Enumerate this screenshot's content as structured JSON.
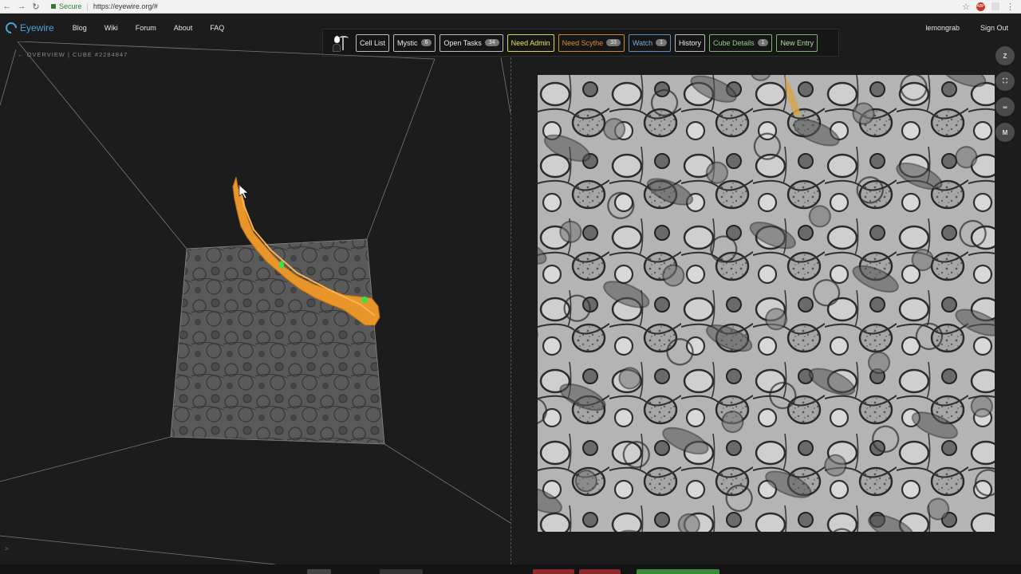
{
  "browser": {
    "secure_label": "Secure",
    "url": "https://eyewire.org/#"
  },
  "site": {
    "brand": "Eyewire",
    "nav": [
      "Blog",
      "Wiki",
      "Forum",
      "About",
      "FAQ"
    ],
    "user": "lemongrab",
    "sign_out": "Sign Out"
  },
  "toolbar": {
    "cell_list": "Cell List",
    "mystic": "Mystic",
    "mystic_count": "6",
    "open_tasks": "Open Tasks",
    "open_tasks_count": "34",
    "need_admin": "Need Admin",
    "need_scythe": "Need Scythe",
    "need_scythe_count": "33",
    "watch": "Watch",
    "watch_count": "1",
    "history": "History",
    "cube_details": "Cube Details",
    "cube_details_count": "1",
    "new_entry": "New Entry"
  },
  "overview": {
    "label": "← OVERVIEW | CUBE #2284847"
  },
  "side_buttons": {
    "z": "Z",
    "m": "M"
  },
  "chat": {
    "prompt": ">"
  },
  "colors": {
    "segment": "#e8962a",
    "seed": "#3ee04a",
    "accent": "#4aa3df"
  }
}
